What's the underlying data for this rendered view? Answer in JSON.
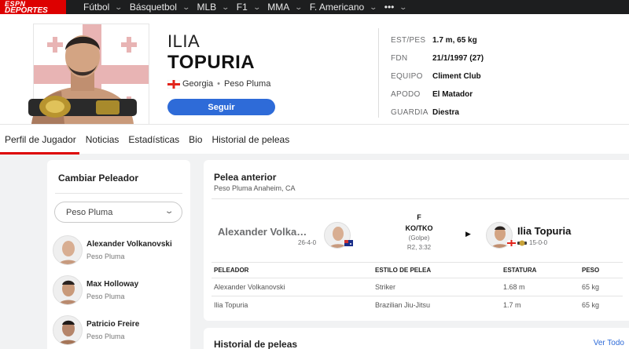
{
  "brand": {
    "line1": "ESPN",
    "line2": "DEPORTES"
  },
  "nav": {
    "items": [
      {
        "label": "Fútbol"
      },
      {
        "label": "Básquetbol"
      },
      {
        "label": "MLB"
      },
      {
        "label": "F1"
      },
      {
        "label": "MMA"
      },
      {
        "label": "F. Americano"
      }
    ],
    "more": "•••"
  },
  "player": {
    "first_name": "ILIA",
    "last_name": "TOPURIA",
    "country": "Georgia",
    "separator": "•",
    "weight_class": "Peso Pluma",
    "follow_label": "Seguir",
    "stats": [
      {
        "key": "EST/PES",
        "value": "1.7 m, 65 kg"
      },
      {
        "key": "FDN",
        "value": "21/1/1997 (27)"
      },
      {
        "key": "EQUIPO",
        "value": "Climent Club"
      },
      {
        "key": "APODO",
        "value": "El Matador"
      },
      {
        "key": "GUARDIA",
        "value": "Diestra"
      }
    ]
  },
  "tabs": [
    {
      "label": "Perfil de Jugador",
      "active": true
    },
    {
      "label": "Noticias"
    },
    {
      "label": "Estadísticas"
    },
    {
      "label": "Bio"
    },
    {
      "label": "Historial de peleas"
    }
  ],
  "switcher": {
    "title": "Cambiar Peleador",
    "selected": "Peso Pluma",
    "fighters": [
      {
        "name": "Alexander Volkanovski",
        "class": "Peso Pluma"
      },
      {
        "name": "Max Holloway",
        "class": "Peso Pluma"
      },
      {
        "name": "Patricio Freire",
        "class": "Peso Pluma"
      }
    ]
  },
  "last_fight": {
    "title": "Pelea anterior",
    "subtitle": "Peso Pluma Anaheim, CA",
    "fighter1": {
      "name": "Alexander Volka…",
      "record": "26-4-0"
    },
    "fighter2": {
      "name": "Ilia Topuria",
      "record": "15-0-0"
    },
    "result": {
      "outcome": "F",
      "method": "KO/TKO",
      "detail": "(Golpe)",
      "round": "R2, 3:32"
    },
    "arrow": "▶",
    "table": {
      "headers": [
        "PELEADOR",
        "ESTILO DE PELEA",
        "ESTATURA",
        "PESO"
      ],
      "rows": [
        [
          "Alexander Volkanovski",
          "Striker",
          "1.68 m",
          "65 kg"
        ],
        [
          "Ilia Topuria",
          "Brazilian Jiu-Jitsu",
          "1.7 m",
          "65 kg"
        ]
      ]
    }
  },
  "history": {
    "title": "Historial de peleas",
    "link": "Ver Todo"
  },
  "colors": {
    "accent_red": "#dd0000",
    "follow_blue": "#2e6bd8",
    "nav_bg": "#1d1e1f"
  },
  "icons": {
    "chevron": "chevron-down-icon",
    "flag_georgia": "georgia-flag-icon",
    "flag_australia": "australia-flag-icon",
    "belt": "championship-belt-icon"
  }
}
